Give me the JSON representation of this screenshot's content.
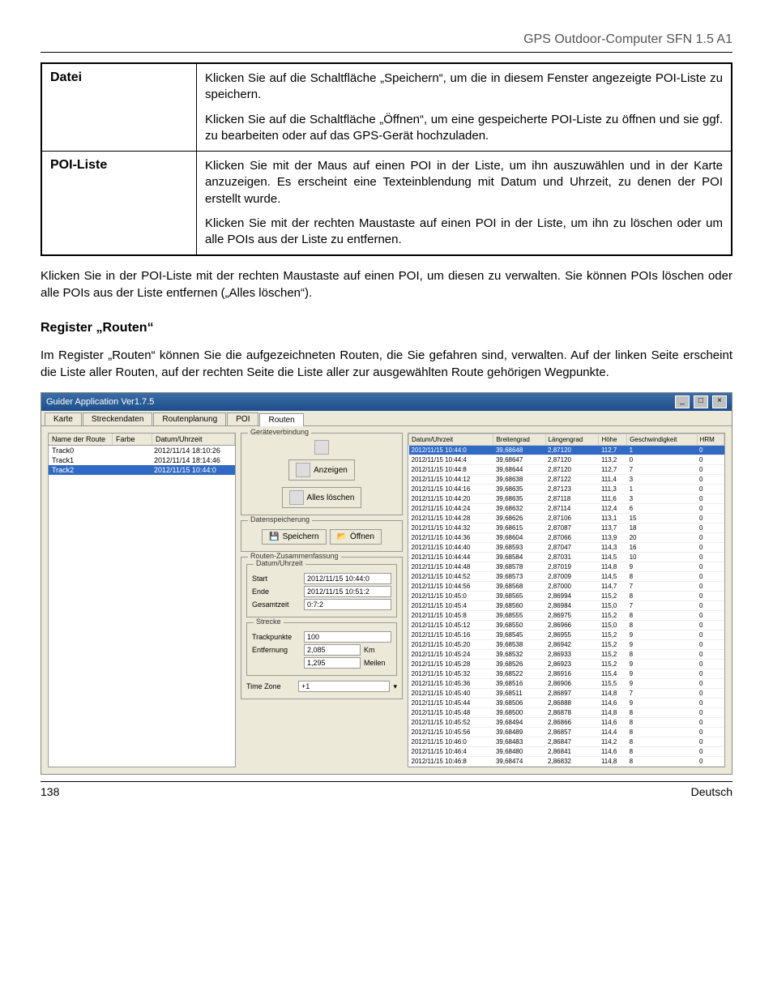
{
  "header": "GPS Outdoor-Computer SFN 1.5 A1",
  "definitions": [
    {
      "term": "Datei",
      "paras": [
        "Klicken Sie auf die Schaltfläche „Speichern“, um die in diesem Fenster angezeigte POI-Liste zu speichern.",
        "Klicken Sie auf die Schaltfläche „Öffnen“, um eine gespeicherte POI-Liste zu öffnen und sie ggf. zu bearbeiten oder auf das GPS-Gerät hochzuladen."
      ]
    },
    {
      "term": "POI-Liste",
      "paras": [
        "Klicken Sie mit der Maus auf einen POI in der Liste, um ihn auszuwählen und in der Karte anzuzeigen. Es erscheint eine Texteinblendung mit Datum und Uhrzeit, zu denen der POI erstellt wurde.",
        "Klicken Sie mit der rechten Maustaste auf einen POI in der Liste, um ihn zu löschen oder um alle POIs aus der Liste zu entfernen."
      ]
    }
  ],
  "para_after": "Klicken Sie in der POI-Liste mit der rechten Maustaste auf einen POI, um diesen zu verwalten. Sie können POIs löschen oder alle POIs aus der Liste entfernen („Alles löschen“).",
  "section_title": "Register „Routen“",
  "section_body": "Im Register „Routen“ können Sie die aufgezeichneten Routen, die Sie gefahren sind, verwalten. Auf der linken Seite erscheint die Liste aller Routen, auf der rechten Seite die Liste aller zur ausgewählten Route gehörigen Wegpunkte.",
  "ss": {
    "title": "Guider Application Ver1.7.5",
    "tabs": [
      "Karte",
      "Streckendaten",
      "Routenplanung",
      "POI",
      "Routen"
    ],
    "active_tab": 4,
    "left": {
      "headers": [
        "Name der Route",
        "Farbe",
        "Datum/Uhrzeit"
      ],
      "rows": [
        {
          "name": "Track0",
          "farbe": "",
          "dt": "2012/11/14 18:10:26",
          "sel": false
        },
        {
          "name": "Track1",
          "farbe": "",
          "dt": "2012/11/14 18:14:46",
          "sel": false
        },
        {
          "name": "Track2",
          "farbe": "",
          "dt": "2012/11/15 10:44:0",
          "sel": true
        }
      ]
    },
    "mid": {
      "g1": {
        "title": "Geräteverbindung",
        "b_anzeigen": "Anzeigen",
        "b_alles": "Alles löschen"
      },
      "g2": {
        "title": "Datenspeicherung",
        "b_speichern": "Speichern",
        "b_oeffnen": "Öffnen"
      },
      "g3": {
        "title": "Routen-Zusammenfassung",
        "sub1": {
          "title": "Datum/Uhrzeit",
          "start_l": "Start",
          "start_v": "2012/11/15 10:44:0",
          "ende_l": "Ende",
          "ende_v": "2012/11/15 10:51:2",
          "gesamt_l": "Gesamtzeit",
          "gesamt_v": "0:7:2"
        },
        "sub2": {
          "title": "Strecke",
          "tp_l": "Trackpunkte",
          "tp_v": "100",
          "ent_l": "Entfernung",
          "ent_v": "2,085",
          "ent_u": "Km",
          "mi_v": "1,295",
          "mi_u": "Meilen"
        },
        "tz_l": "Time Zone",
        "tz_v": "+1"
      }
    },
    "right": {
      "headers": [
        "Datum/Uhrzeit",
        "Breitengrad",
        "Längengrad",
        "Höhe",
        "Geschwindigkeit",
        "HRM"
      ],
      "rows": [
        [
          "2012/11/15 10:44:0",
          "39,68648",
          "2,87120",
          "112,7",
          "1",
          "0"
        ],
        [
          "2012/11/15 10:44:4",
          "39,68647",
          "2,87120",
          "113,2",
          "0",
          "0"
        ],
        [
          "2012/11/15 10:44:8",
          "39,68644",
          "2,87120",
          "112,7",
          "7",
          "0"
        ],
        [
          "2012/11/15 10:44:12",
          "39,68638",
          "2,87122",
          "111,4",
          "3",
          "0"
        ],
        [
          "2012/11/15 10:44:16",
          "39,68635",
          "2,87123",
          "111,3",
          "1",
          "0"
        ],
        [
          "2012/11/15 10:44:20",
          "39,68635",
          "2,87118",
          "111,6",
          "3",
          "0"
        ],
        [
          "2012/11/15 10:44:24",
          "39,68632",
          "2,87114",
          "112,4",
          "6",
          "0"
        ],
        [
          "2012/11/15 10:44:28",
          "39,68626",
          "2,87106",
          "113,1",
          "15",
          "0"
        ],
        [
          "2012/11/15 10:44:32",
          "39,68615",
          "2,87087",
          "113,7",
          "18",
          "0"
        ],
        [
          "2012/11/15 10:44:36",
          "39,68604",
          "2,87066",
          "113,9",
          "20",
          "0"
        ],
        [
          "2012/11/15 10:44:40",
          "39,68593",
          "2,87047",
          "114,3",
          "16",
          "0"
        ],
        [
          "2012/11/15 10:44:44",
          "39,68584",
          "2,87031",
          "114,5",
          "10",
          "0"
        ],
        [
          "2012/11/15 10:44:48",
          "39,68578",
          "2,87019",
          "114,8",
          "9",
          "0"
        ],
        [
          "2012/11/15 10:44:52",
          "39,68573",
          "2,87009",
          "114,5",
          "8",
          "0"
        ],
        [
          "2012/11/15 10:44:56",
          "39,68568",
          "2,87000",
          "114,7",
          "7",
          "0"
        ],
        [
          "2012/11/15 10:45:0",
          "39,68565",
          "2,86994",
          "115,2",
          "8",
          "0"
        ],
        [
          "2012/11/15 10:45:4",
          "39,68560",
          "2,86984",
          "115,0",
          "7",
          "0"
        ],
        [
          "2012/11/15 10:45:8",
          "39,68555",
          "2,86975",
          "115,2",
          "8",
          "0"
        ],
        [
          "2012/11/15 10:45:12",
          "39,68550",
          "2,86966",
          "115,0",
          "8",
          "0"
        ],
        [
          "2012/11/15 10:45:16",
          "39,68545",
          "2,86955",
          "115,2",
          "9",
          "0"
        ],
        [
          "2012/11/15 10:45:20",
          "39,68538",
          "2,86942",
          "115,2",
          "9",
          "0"
        ],
        [
          "2012/11/15 10:45:24",
          "39,68532",
          "2,86933",
          "115,2",
          "8",
          "0"
        ],
        [
          "2012/11/15 10:45:28",
          "39,68526",
          "2,86923",
          "115,2",
          "9",
          "0"
        ],
        [
          "2012/11/15 10:45:32",
          "39,68522",
          "2,86916",
          "115,4",
          "9",
          "0"
        ],
        [
          "2012/11/15 10:45:36",
          "39,68516",
          "2,86906",
          "115,5",
          "9",
          "0"
        ],
        [
          "2012/11/15 10:45:40",
          "39,68511",
          "2,86897",
          "114,8",
          "7",
          "0"
        ],
        [
          "2012/11/15 10:45:44",
          "39,68506",
          "2,86888",
          "114,6",
          "9",
          "0"
        ],
        [
          "2012/11/15 10:45:48",
          "39,68500",
          "2,86878",
          "114,8",
          "8",
          "0"
        ],
        [
          "2012/11/15 10:45:52",
          "39,68494",
          "2,86866",
          "114,6",
          "8",
          "0"
        ],
        [
          "2012/11/15 10:45:56",
          "39,68489",
          "2,86857",
          "114,4",
          "8",
          "0"
        ],
        [
          "2012/11/15 10:46:0",
          "39,68483",
          "2,86847",
          "114,2",
          "8",
          "0"
        ],
        [
          "2012/11/15 10:46:4",
          "39,68480",
          "2,86841",
          "114,6",
          "8",
          "0"
        ],
        [
          "2012/11/15 10:46:8",
          "39,68474",
          "2,86832",
          "114,8",
          "8",
          "0"
        ]
      ]
    }
  },
  "footer": {
    "page": "138",
    "lang": "Deutsch"
  }
}
